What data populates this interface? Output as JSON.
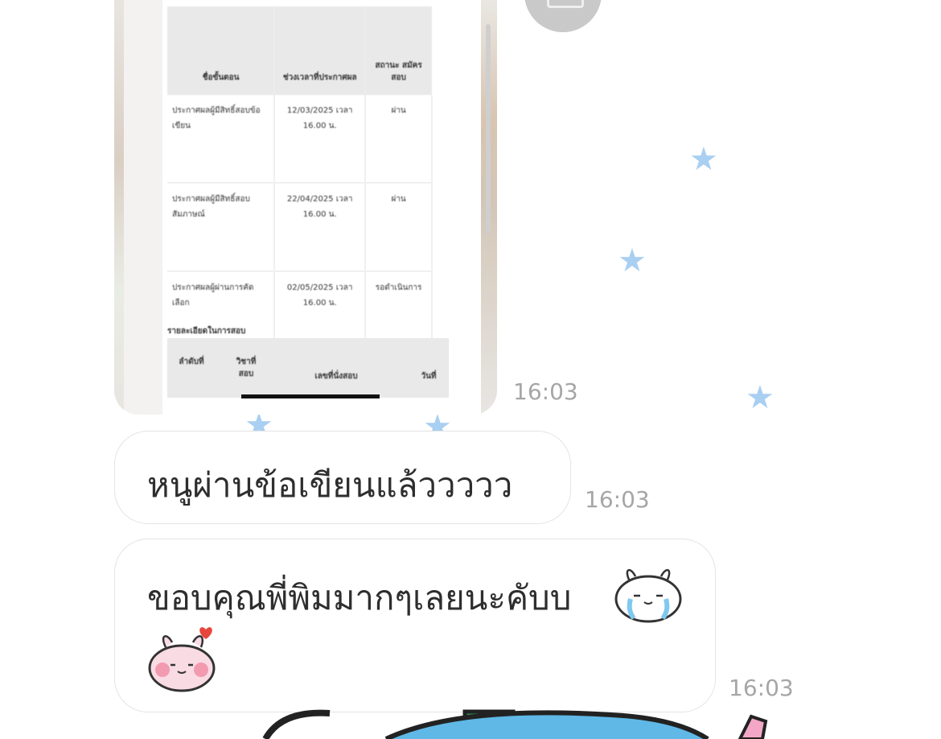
{
  "image_message": {
    "table": {
      "headers": [
        "ชื่อขั้นตอน",
        "ช่วงเวลาที่ประกาศผล",
        "สถานะ สมัคร สอบ"
      ],
      "rows": [
        {
          "step": "ประกาศผลผู้มีสิทธิ์สอบข้อเขียน",
          "date": "12/03/2025 เวลา 16.00 น.",
          "status": "ผ่าน"
        },
        {
          "step": "ประกาศผลผู้มีสิทธิ์สอบสัมภาษณ์",
          "date": "22/04/2025 เวลา 16.00 น.",
          "status": "ผ่าน"
        },
        {
          "step": "ประกาศผลผู้ผ่านการคัดเลือก",
          "date": "02/05/2025 เวลา 16.00 น.",
          "status": "รอดำเนินการ"
        }
      ]
    },
    "sub_title": "รายละเอียดในการสอบ",
    "sub_headers": [
      "ลำดับที่",
      "วิชาที่สอบ",
      "เลขที่นั่งสอบ",
      "วันที่"
    ]
  },
  "messages": [
    {
      "text": "",
      "time": "16:03"
    },
    {
      "text": "หนูผ่านข้อเขียนแล้ววววว",
      "time": "16:03"
    },
    {
      "text": "ขอบคุณพี่พิมมากๆเลยนะคับบ",
      "time": "16:03"
    }
  ],
  "colors": {
    "star": "#a9cff2",
    "bubble_border": "#e4e4e4",
    "time_text": "#a6a6a6"
  }
}
